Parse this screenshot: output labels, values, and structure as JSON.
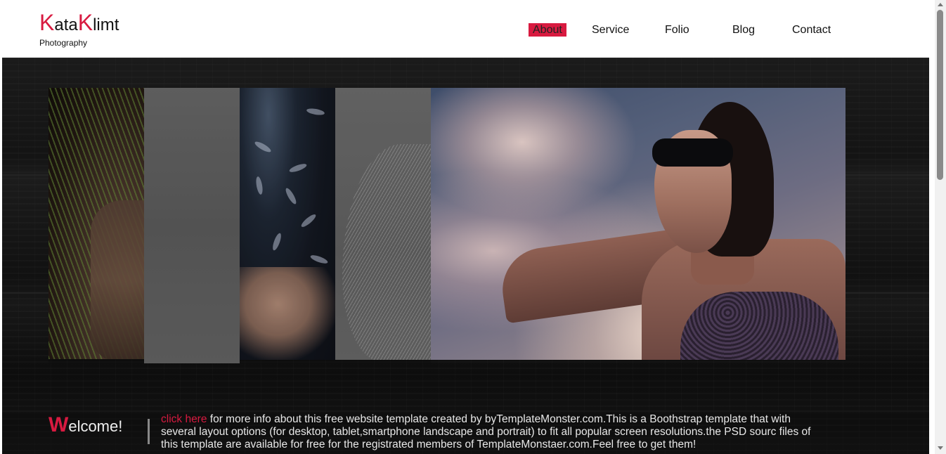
{
  "logo": {
    "cap1": "K",
    "part1": "ata",
    "cap2": "K",
    "part2": "limt",
    "subtitle": "Photography"
  },
  "nav": {
    "items": [
      {
        "label": "About",
        "active": true
      },
      {
        "label": "Service"
      },
      {
        "label": "Folio"
      },
      {
        "label": "Blog"
      },
      {
        "label": "Contact"
      }
    ]
  },
  "welcome": {
    "title_cap": "W",
    "title_rest": "elcome!",
    "link_text": "click here",
    "body": " for more info about this free website template created by byTemplateMonster.com.This is a Boothstrap template that with several layout options (for desktop, tablet,smartphone landscape and portrait) to fit all popular screen resolutions.the PSD sourc files of this template are available for free for the registrated members of TemplateMonstaer.com.Feel free to get them!"
  },
  "colors": {
    "accent": "#d81a40",
    "hero_bg": "#141414",
    "text_light": "#e8e8e8"
  }
}
